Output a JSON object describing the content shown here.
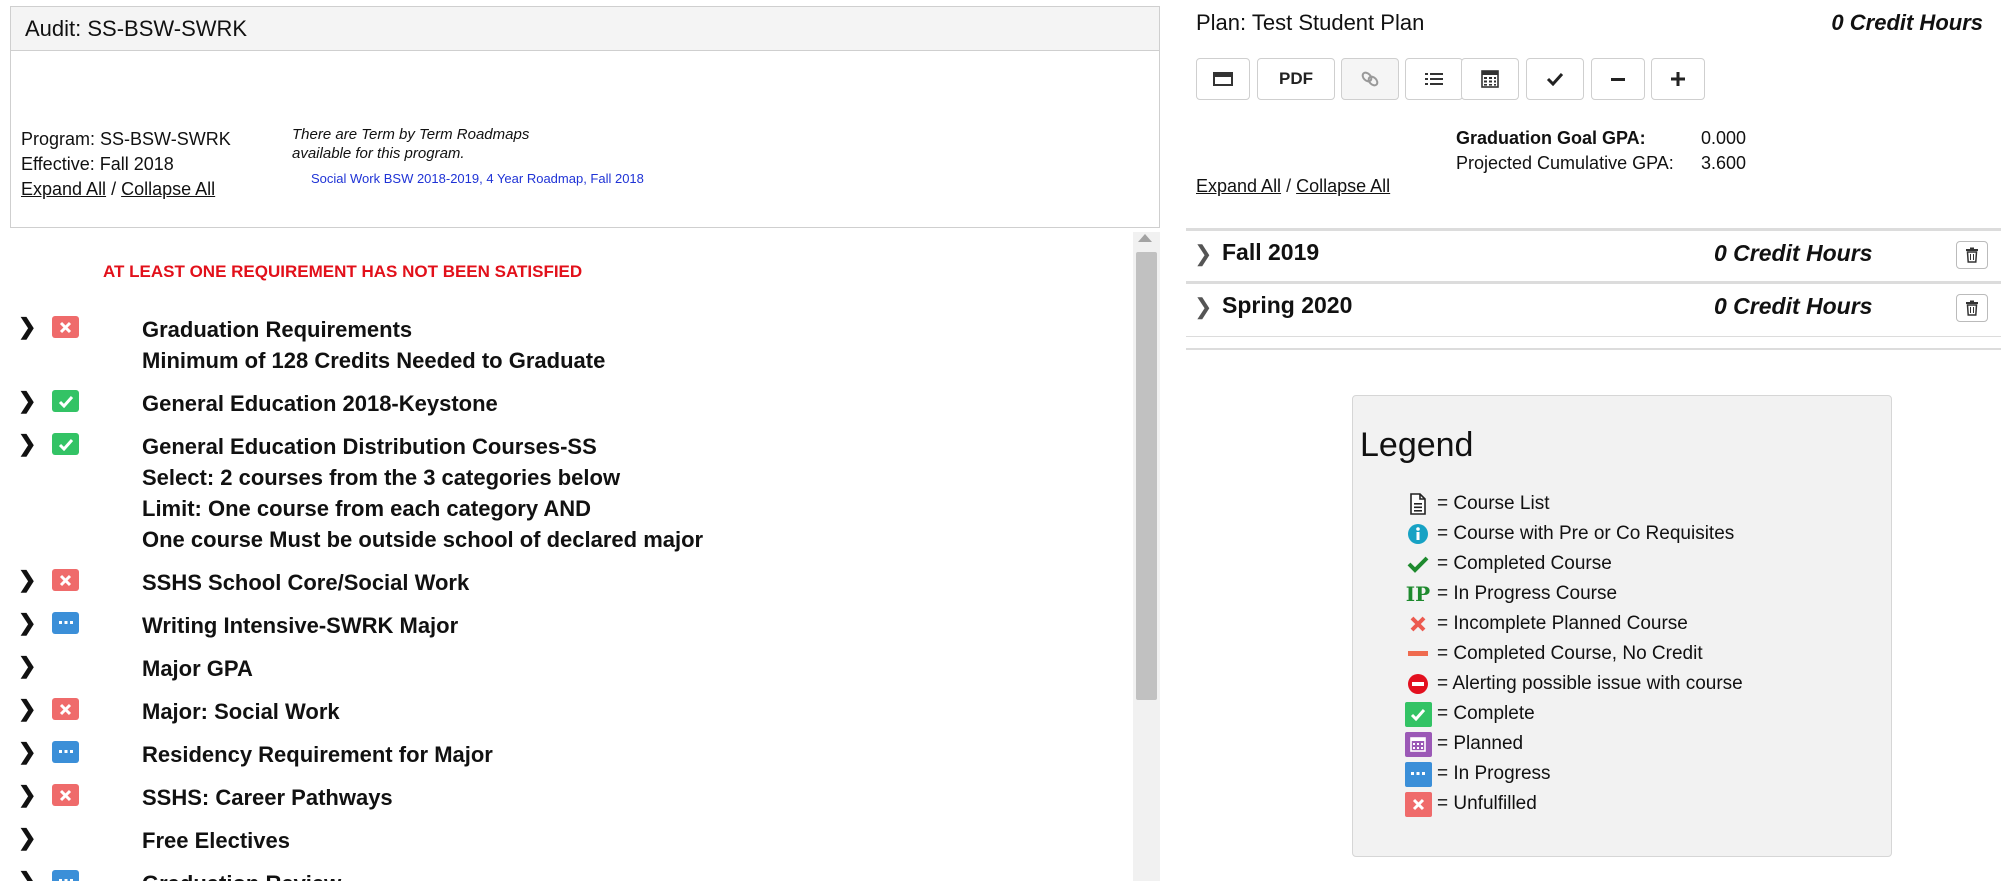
{
  "audit": {
    "title": "Audit: SS-BSW-SWRK",
    "program": "Program: SS-BSW-SWRK",
    "effective": "Effective: Fall 2018",
    "expand_all": "Expand All",
    "separator": "/",
    "collapse_all": "Collapse All",
    "roadmap_note_1": "There are Term by Term Roadmaps",
    "roadmap_note_2": "available for this program.",
    "roadmap_link": "Social Work BSW 2018-2019, 4 Year Roadmap, Fall 2018",
    "warning": "AT LEAST ONE REQUIREMENT HAS NOT BEEN SATISFIED"
  },
  "requirements": [
    {
      "status": "unfulfilled",
      "lines": [
        "Graduation Requirements",
        "Minimum of 128 Credits Needed to Graduate"
      ]
    },
    {
      "status": "complete",
      "lines": [
        "General Education 2018-Keystone"
      ]
    },
    {
      "status": "complete",
      "lines": [
        "General Education Distribution Courses-SS",
        "Select: 2 courses from the 3 categories below",
        "Limit: One course from each category AND",
        "One course Must be outside school of declared major"
      ]
    },
    {
      "status": "unfulfilled",
      "lines": [
        "SSHS School Core/Social Work"
      ]
    },
    {
      "status": "inprogress",
      "lines": [
        "Writing Intensive-SWRK Major"
      ]
    },
    {
      "status": "none",
      "lines": [
        "Major GPA"
      ]
    },
    {
      "status": "unfulfilled",
      "lines": [
        "Major: Social Work"
      ]
    },
    {
      "status": "inprogress",
      "lines": [
        "Residency Requirement for Major"
      ]
    },
    {
      "status": "unfulfilled",
      "lines": [
        "SSHS: Career Pathways"
      ]
    },
    {
      "status": "none",
      "lines": [
        "Free Electives"
      ]
    },
    {
      "status": "inprogress",
      "lines": [
        "Graduation Review"
      ]
    }
  ],
  "plan": {
    "title": "Plan: Test Student Plan",
    "credits": "0 Credit Hours",
    "toolbar": {
      "pdf_label": "PDF"
    },
    "gpa_goal_label": "Graduation Goal GPA:",
    "gpa_goal_value": "0.000",
    "gpa_proj_label": "Projected Cumulative GPA:",
    "gpa_proj_value": "3.600",
    "expand_all": "Expand All",
    "separator": "/",
    "collapse_all": "Collapse All",
    "terms": [
      {
        "name": "Fall 2019",
        "credits": "0 Credit Hours"
      },
      {
        "name": "Spring 2020",
        "credits": "0 Credit Hours"
      }
    ]
  },
  "legend": {
    "title": "Legend",
    "items": [
      {
        "icon": "course-list-icon",
        "label": "= Course List"
      },
      {
        "icon": "info-icon",
        "label": "= Course with Pre or Co Requisites"
      },
      {
        "icon": "checkmark-icon",
        "label": "= Completed Course"
      },
      {
        "icon": "ip-icon",
        "label": "= In Progress Course",
        "glyph": "IP"
      },
      {
        "icon": "x-icon",
        "label": "= Incomplete Planned Course"
      },
      {
        "icon": "dash-icon",
        "label": "= Completed Course, No Credit"
      },
      {
        "icon": "no-entry-icon",
        "label": "= Alerting possible issue with course"
      },
      {
        "icon": "complete-square-icon",
        "label": "= Complete"
      },
      {
        "icon": "planned-square-icon",
        "label": "= Planned"
      },
      {
        "icon": "in-progress-square-icon",
        "label": "= In Progress"
      },
      {
        "icon": "unfulfilled-square-icon",
        "label": "= Unfulfilled"
      }
    ]
  },
  "colors": {
    "warning": "#e2101a",
    "unfulfilled": "#ef6b6b",
    "complete": "#33c365",
    "in_progress": "#3b8fd8",
    "planned": "#9b59b6",
    "link": "#1f33d6"
  }
}
